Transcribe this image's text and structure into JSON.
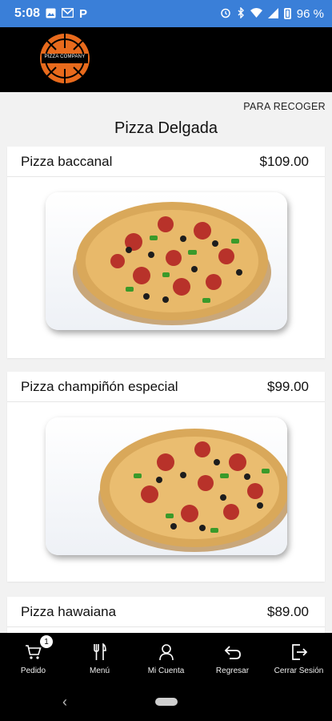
{
  "status_bar": {
    "time": "5:08",
    "carrier_glyph": "P",
    "battery_percent": "96 %",
    "icons": [
      "image-icon",
      "gmail-icon",
      "p-icon",
      "alarm-icon",
      "bluetooth-icon",
      "wifi-icon",
      "signal-icon",
      "battery-icon"
    ]
  },
  "header": {
    "logo_text": "PIZZA COMPANY",
    "logo_color": "#e86a1c"
  },
  "order_mode": "PARA RECOGER",
  "section_title": "Pizza Delgada",
  "products": [
    {
      "name": "Pizza baccanal",
      "price": "$109.00"
    },
    {
      "name": "Pizza champiñón especial",
      "price": "$99.00"
    },
    {
      "name": "Pizza hawaiana",
      "price": "$89.00"
    }
  ],
  "bottom_nav": {
    "cart_badge": "1",
    "items": [
      {
        "label": "Pedido",
        "icon": "cart-icon"
      },
      {
        "label": "Menú",
        "icon": "utensils-icon"
      },
      {
        "label": "Mi Cuenta",
        "icon": "user-icon"
      },
      {
        "label": "Regresar",
        "icon": "back-arrow-icon"
      },
      {
        "label": "Cerrar Sesión",
        "icon": "logout-icon"
      }
    ]
  },
  "colors": {
    "status_bar": "#3a7fd8",
    "header_bg": "#000000",
    "page_bg": "#f2f2f2"
  }
}
